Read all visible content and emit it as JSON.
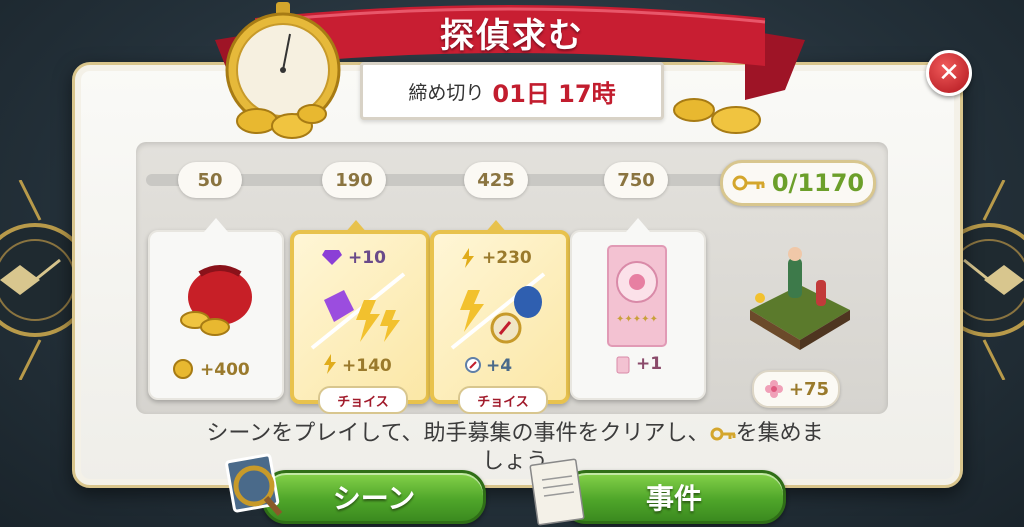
{
  "header": {
    "title": "探偵求む",
    "deadline_label": "締め切り",
    "deadline_value": "01日 17時",
    "close_symbol": "✕"
  },
  "progress": {
    "milestones": [
      "50",
      "190",
      "425",
      "750"
    ],
    "keys_value": "0/1170"
  },
  "rewards": [
    {
      "top": "",
      "bottom": "+400",
      "icon": "coin-sack-icon",
      "choice": ""
    },
    {
      "top": "+10",
      "bottom": "+140",
      "icon": "gem-and-lightning-icon",
      "choice": "チョイス"
    },
    {
      "top": "+230",
      "bottom": "+4",
      "icon": "lightning-and-compass-icon",
      "choice": "チョイス"
    },
    {
      "top": "",
      "bottom": "+1",
      "icon": "pink-card-icon",
      "choice": ""
    }
  ],
  "bonus": {
    "flower_value": "+75"
  },
  "instructions": {
    "before_key": "シーンをプレイして、助手募集の事件をクリアし、",
    "after_key": "を集めま",
    "line2": "しょう"
  },
  "buttons": {
    "scene": "シーン",
    "case": "事件"
  },
  "colors": {
    "ribbon": "#c81e32",
    "accent_gold": "#e8c24d",
    "key_green": "#6c9f2a",
    "button_green": "#4fa62a"
  }
}
